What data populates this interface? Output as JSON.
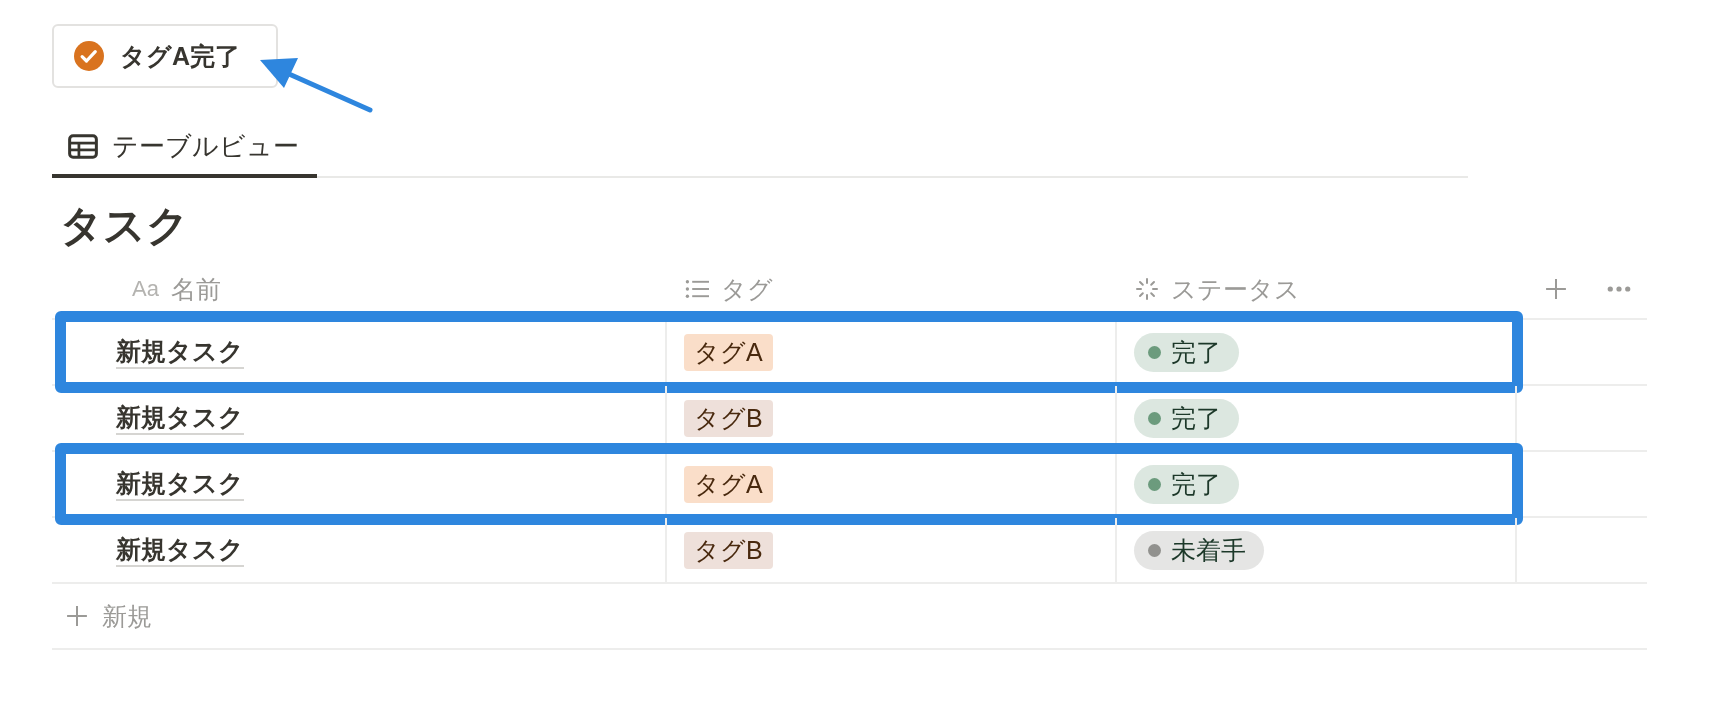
{
  "button": {
    "label": "タグA完了"
  },
  "tabs": [
    {
      "label": "テーブルビュー",
      "selected": true
    }
  ],
  "title": "タスク",
  "table": {
    "columns": [
      {
        "kind": "text",
        "prefix": "Aa",
        "label": "名前"
      },
      {
        "kind": "list",
        "label": "タグ"
      },
      {
        "kind": "status",
        "label": "ステータス"
      }
    ],
    "rows": [
      {
        "name": "新規タスク",
        "tag": {
          "label": "タグA",
          "color": "#fadec9"
        },
        "status": {
          "label": "完了",
          "color": "#6c9b7d"
        },
        "highlighted": true
      },
      {
        "name": "新規タスク",
        "tag": {
          "label": "タグB",
          "color": "#eee0da"
        },
        "status": {
          "label": "完了",
          "color": "#6c9b7d"
        },
        "highlighted": false
      },
      {
        "name": "新規タスク",
        "tag": {
          "label": "タグA",
          "color": "#fadec9"
        },
        "status": {
          "label": "完了",
          "color": "#6c9b7d"
        },
        "highlighted": true
      },
      {
        "name": "新規タスク",
        "tag": {
          "label": "タグB",
          "color": "#eee0da"
        },
        "status": {
          "label": "未着手",
          "color": "#91918e"
        },
        "highlighted": false
      }
    ],
    "new_row": "新規"
  }
}
